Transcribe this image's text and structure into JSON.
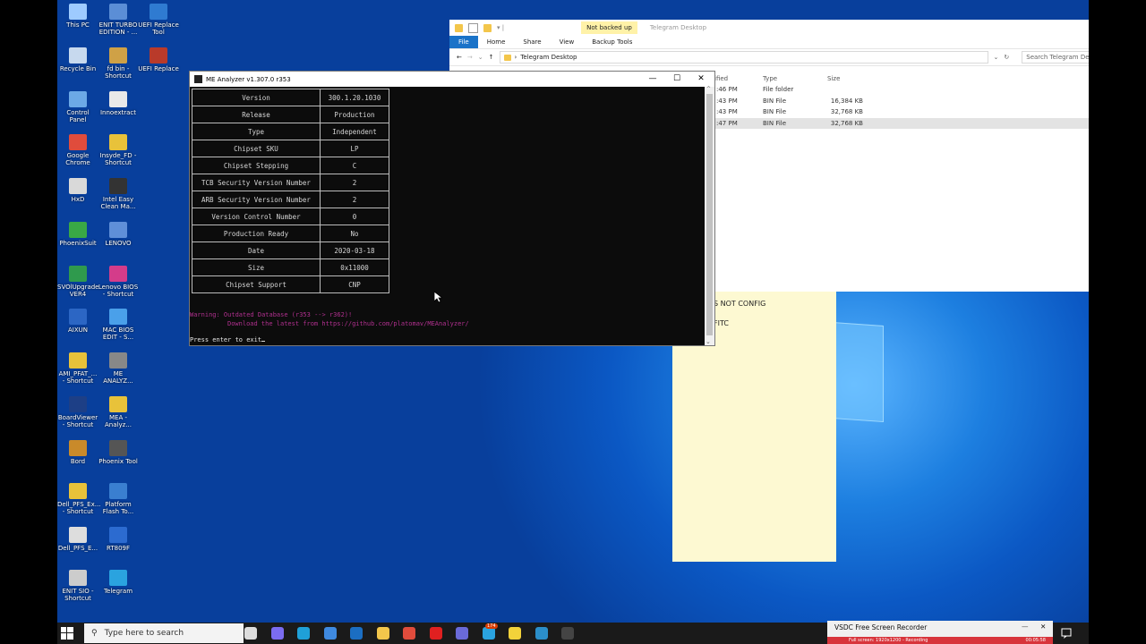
{
  "desktop_icons": [
    {
      "label": "This PC",
      "color": "#9ecbff"
    },
    {
      "label": "ENIT TURBO EDITION - ...",
      "color": "#5b8ed6"
    },
    {
      "label": "UEFI Replace Tool",
      "color": "#2f7bd1"
    },
    {
      "label": "Recycle Bin",
      "color": "#c7d9ee"
    },
    {
      "label": "fd bin - Shortcut",
      "color": "#cfa146"
    },
    {
      "label": "UEFI Replace",
      "color": "#b93a2a"
    },
    {
      "label": "Control Panel",
      "color": "#6ca9e6"
    },
    {
      "label": "Innoextract",
      "color": "#e9e9e9"
    },
    {
      "label": "Google Chrome",
      "color": "#e04c3c"
    },
    {
      "label": "Insyde_FD - Shortcut",
      "color": "#e8c23a"
    },
    {
      "label": "HxD",
      "color": "#d9d9d9"
    },
    {
      "label": "Intel Easy Clean Ma...",
      "color": "#333333"
    },
    {
      "label": "PhoenixSuit",
      "color": "#39a845"
    },
    {
      "label": "LENOVO",
      "color": "#5f8fd8"
    },
    {
      "label": "SVOlUpgrade VER4",
      "color": "#2f9a4d"
    },
    {
      "label": "Lenovo BIOS - Shortcut",
      "color": "#d43c8a"
    },
    {
      "label": "AIXUN",
      "color": "#2c66c4"
    },
    {
      "label": "MAC BIOS EDIT - S...",
      "color": "#4aa0ea"
    },
    {
      "label": "AMI_PFAT_... - Shortcut",
      "color": "#e8c23a"
    },
    {
      "label": "ME ANALYZ...",
      "color": "#888888"
    },
    {
      "label": "BoardViewer - Shortcut",
      "color": "#1d3f86"
    },
    {
      "label": "MEA - Analyz...",
      "color": "#e8c23a"
    },
    {
      "label": "Bord",
      "color": "#c98a2a"
    },
    {
      "label": "Phoenix Tool",
      "color": "#555555"
    },
    {
      "label": "Dell_PFS_Ex... - Shortcut",
      "color": "#e8c23a"
    },
    {
      "label": "Platform Flash To...",
      "color": "#3a7fd0"
    },
    {
      "label": "Dell_PFS_E...",
      "color": "#dddddd"
    },
    {
      "label": "RT809F",
      "color": "#2c6bd0"
    },
    {
      "label": "ENIT SIO - Shortcut",
      "color": "#cccccc"
    },
    {
      "label": "Telegram",
      "color": "#2aa3df"
    }
  ],
  "explorer": {
    "not_backed_up": "Not backed up",
    "title": "Telegram Desktop",
    "ribbon_tabs": [
      "File",
      "Home",
      "Share",
      "View",
      "Backup Tools"
    ],
    "breadcrumb": "Telegram Desktop",
    "search_placeholder": "Search Telegram Desktop",
    "columns": {
      "modified": "ified",
      "type": "Type",
      "size": "Size"
    },
    "rows": [
      {
        "modified": ":46 PM",
        "type": "File folder",
        "size": ""
      },
      {
        "modified": ":43 PM",
        "type": "BIN File",
        "size": "16,384 KB"
      },
      {
        "modified": ":43 PM",
        "type": "BIN File",
        "size": "32,768 KB"
      },
      {
        "modified": ":47 PM",
        "type": "BIN File",
        "size": "32,768 KB"
      }
    ]
  },
  "sticky": {
    "line1": "S NOT CONFIG",
    "line2": "FITC"
  },
  "console": {
    "title": "ME Analyzer v1.307.0 r353",
    "table": [
      {
        "k": "Version",
        "v": "300.1.20.1030"
      },
      {
        "k": "Release",
        "v": "Production"
      },
      {
        "k": "Type",
        "v": "Independent"
      },
      {
        "k": "Chipset SKU",
        "v": "LP"
      },
      {
        "k": "Chipset Stepping",
        "v": "C"
      },
      {
        "k": "TCB Security Version Number",
        "v": "2"
      },
      {
        "k": "ARB Security Version Number",
        "v": "2"
      },
      {
        "k": "Version Control Number",
        "v": "0"
      },
      {
        "k": "Production Ready",
        "v": "No"
      },
      {
        "k": "Date",
        "v": "2020-03-18"
      },
      {
        "k": "Size",
        "v": "0x11000"
      },
      {
        "k": "Chipset Support",
        "v": "CNP"
      }
    ],
    "warning1": "Warning: Outdated Database (r353 --> r362)!",
    "warning2": "Download the latest from https://github.com/platomav/MEAnalyzer/",
    "prompt": "Press enter to exit",
    "warning_color": "#b0308e"
  },
  "taskbar": {
    "search_placeholder": "Type here to search",
    "apps": [
      {
        "name": "task-view",
        "color": "#dddddd"
      },
      {
        "name": "copilot",
        "color": "#7b6cf0"
      },
      {
        "name": "edge",
        "color": "#1fa0d8"
      },
      {
        "name": "store",
        "color": "#3f8ae0"
      },
      {
        "name": "outlook",
        "color": "#1b6ec2"
      },
      {
        "name": "file-explorer",
        "color": "#f3c64b"
      },
      {
        "name": "chrome",
        "color": "#e04c3c"
      },
      {
        "name": "youtube",
        "color": "#e02020"
      },
      {
        "name": "vpn",
        "color": "#6a6ad8"
      },
      {
        "name": "telegram",
        "color": "#2aa3df"
      },
      {
        "name": "sticky-notes",
        "color": "#f3d23a"
      },
      {
        "name": "monitor",
        "color": "#2b8ec9"
      },
      {
        "name": "me-analyzer",
        "color": "#444444"
      }
    ],
    "badge": "174"
  },
  "vsdc": {
    "title": "VSDC Free Screen Recorder",
    "status": "Full screen: 1920x1200 - Recording",
    "timer": "00:05:58"
  }
}
